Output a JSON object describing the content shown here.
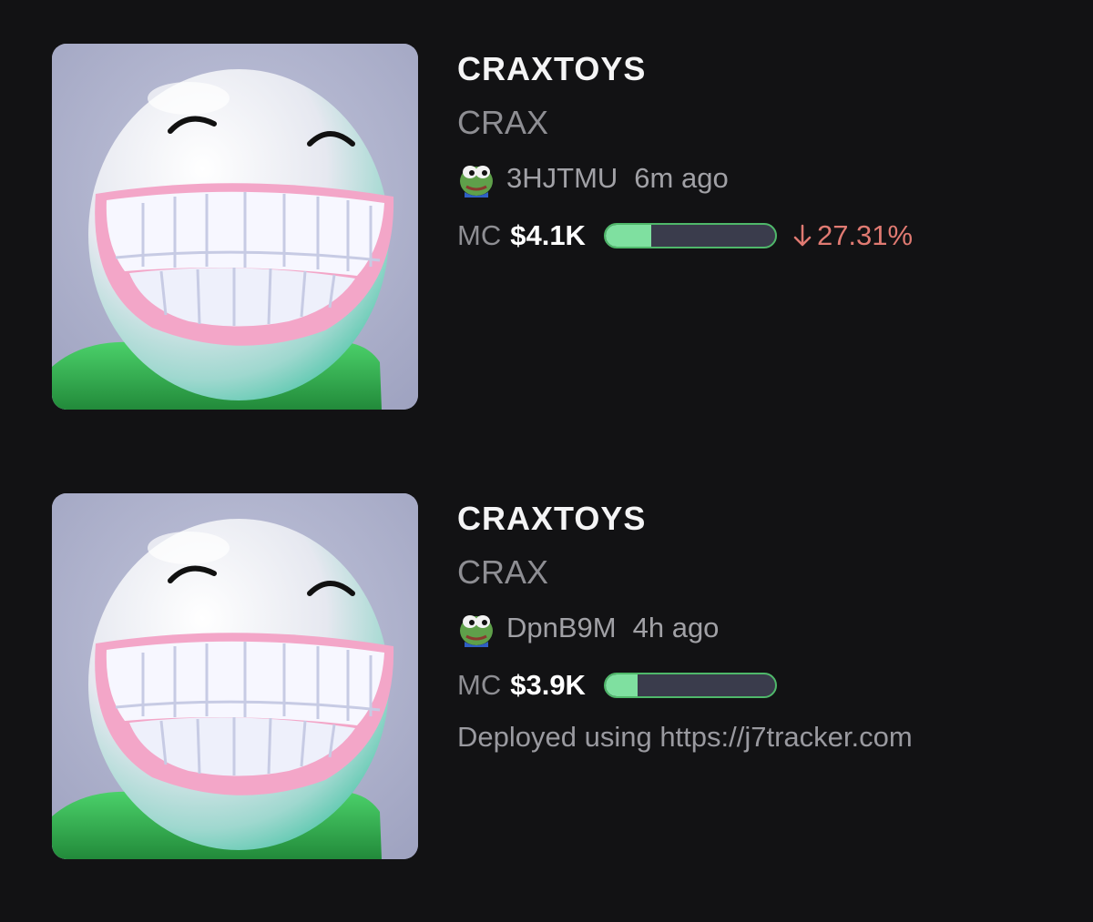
{
  "colors": {
    "background": "#121214",
    "progress_fill": "#7fe0a0",
    "progress_track": "#3a3c4c",
    "progress_border": "#4fb86a",
    "negative_change": "#e07a72"
  },
  "tokens": [
    {
      "name": "CRAXTOYS",
      "ticker": "CRAX",
      "creator_icon": "pepe-frog-avatar",
      "creator": "3HJTMU",
      "time": "6m ago",
      "mc_label": "MC",
      "mc_value": "$4.1K",
      "progress": 0.27,
      "change_icon": "arrow-down-icon",
      "change": "27.31%"
    },
    {
      "name": "CRAXTOYS",
      "ticker": "CRAX",
      "creator_icon": "pepe-frog-avatar",
      "creator": "DpnB9M",
      "time": "4h ago",
      "mc_label": "MC",
      "mc_value": "$3.9K",
      "progress": 0.19,
      "description": "Deployed using https://j7tracker.com"
    }
  ]
}
